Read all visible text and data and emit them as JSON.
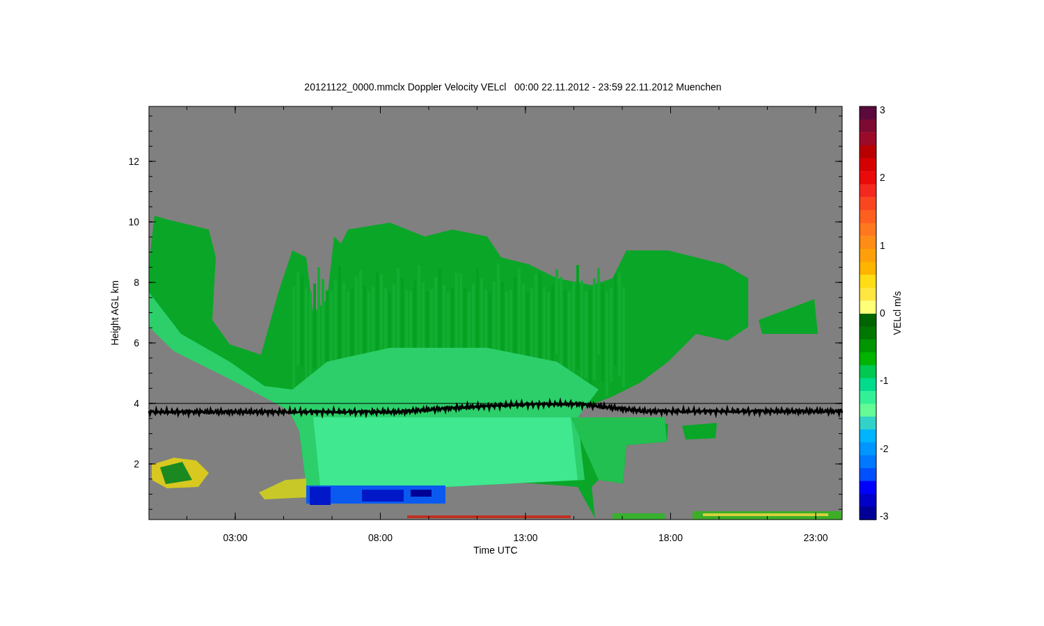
{
  "title": "20121122_0000.mmclx Doppler Velocity VELcl   00:00 22.11.2012 - 23:59 22.11.2012 Muenchen",
  "plot": {
    "ylabel": "Height AGL km",
    "xlabel": "Time UTC",
    "yticks": [
      "12",
      "10",
      "8",
      "6",
      "4",
      "2"
    ],
    "xticks": [
      "03:00",
      "08:00",
      "13:00",
      "18:00",
      "23:00"
    ]
  },
  "colorbar": {
    "label": "VELcl m/s",
    "ticks": [
      "3",
      "2",
      "1",
      "0",
      "-1",
      "-2",
      "-3"
    ]
  }
}
